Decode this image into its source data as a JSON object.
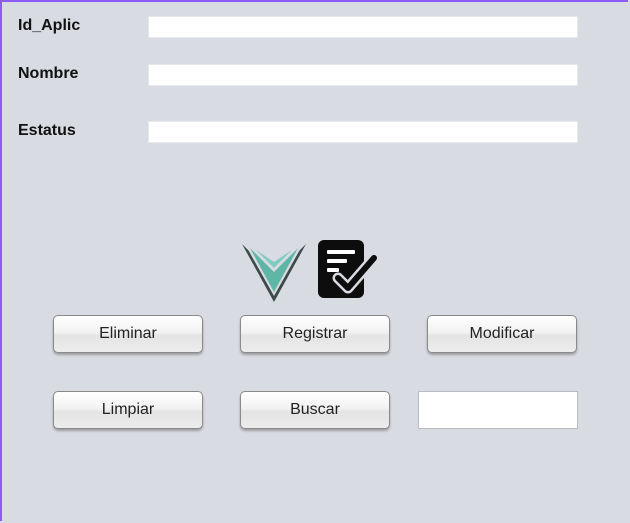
{
  "form": {
    "fields": [
      {
        "label": "Id_Aplic",
        "value": "",
        "placeholder": ""
      },
      {
        "label": "Nombre",
        "value": "",
        "placeholder": ""
      },
      {
        "label": "Estatus",
        "value": "",
        "placeholder": ""
      }
    ]
  },
  "icons": {
    "logo": "teal-chevron-logo",
    "register": "document-check-icon"
  },
  "buttons": {
    "eliminar": "Eliminar",
    "registrar": "Registrar",
    "modificar": "Modificar",
    "limpiar": "Limpiar",
    "buscar": "Buscar"
  },
  "search": {
    "value": "",
    "placeholder": ""
  },
  "colors": {
    "background": "#d8dbe1",
    "window_border": "#8b5cf6",
    "logo_teal": "#5fb5a6",
    "logo_dark": "#3d4a4a"
  }
}
